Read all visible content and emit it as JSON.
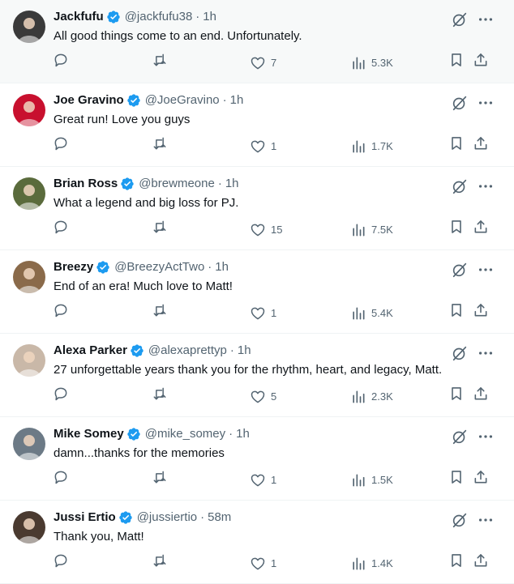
{
  "tweets": [
    {
      "name": "Jackfufu",
      "handle": "@jackfufu38",
      "separator": "·",
      "time": "1h",
      "text": "All good things come to an end. Unfortunately.",
      "replies": "",
      "retweets": "",
      "likes": "7",
      "views": "5.3K",
      "avatar_color": "#3a3a3a"
    },
    {
      "name": "Joe Gravino",
      "handle": "@JoeGravino",
      "separator": "·",
      "time": "1h",
      "text": "Great run! Love you guys",
      "replies": "",
      "retweets": "",
      "likes": "1",
      "views": "1.7K",
      "avatar_color": "#c8102e"
    },
    {
      "name": "Brian Ross",
      "handle": "@brewmeone",
      "separator": "·",
      "time": "1h",
      "text": "What a legend and big loss for PJ.",
      "replies": "",
      "retweets": "",
      "likes": "15",
      "views": "7.5K",
      "avatar_color": "#5a6b3c"
    },
    {
      "name": "Breezy",
      "handle": "@BreezyActTwo",
      "separator": "·",
      "time": "1h",
      "text": "End of an era! Much love to Matt!",
      "replies": "",
      "retweets": "",
      "likes": "1",
      "views": "5.4K",
      "avatar_color": "#8a6a4a"
    },
    {
      "name": "Alexa Parker",
      "handle": "@alexaprettyp",
      "separator": "·",
      "time": "1h",
      "text": "27 unforgettable years thank you for the rhythm, heart, and legacy, Matt.",
      "replies": "",
      "retweets": "",
      "likes": "5",
      "views": "2.3K",
      "avatar_color": "#c9b8a8"
    },
    {
      "name": "Mike Somey",
      "handle": "@mike_somey",
      "separator": "·",
      "time": "1h",
      "text": "damn...thanks for the memories",
      "replies": "",
      "retweets": "",
      "likes": "1",
      "views": "1.5K",
      "avatar_color": "#6c7a86"
    },
    {
      "name": "Jussi Ertio",
      "handle": "@jussiertio",
      "separator": "·",
      "time": "58m",
      "text": "Thank you, Matt!",
      "replies": "",
      "retweets": "",
      "likes": "1",
      "views": "1.4K",
      "avatar_color": "#4a3a30"
    }
  ],
  "icons": {
    "verified": "verified-badge-icon",
    "grok": "grok-icon",
    "more": "more-icon",
    "reply": "reply-icon",
    "retweet": "retweet-icon",
    "like": "heart-icon",
    "views": "views-icon",
    "bookmark": "bookmark-icon",
    "share": "share-icon"
  },
  "colors": {
    "verified": "#1d9bf0",
    "secondary_text": "#536471",
    "primary_text": "#0f1419",
    "divider": "#eff3f4",
    "highlight_bg": "#f7f9f9"
  }
}
